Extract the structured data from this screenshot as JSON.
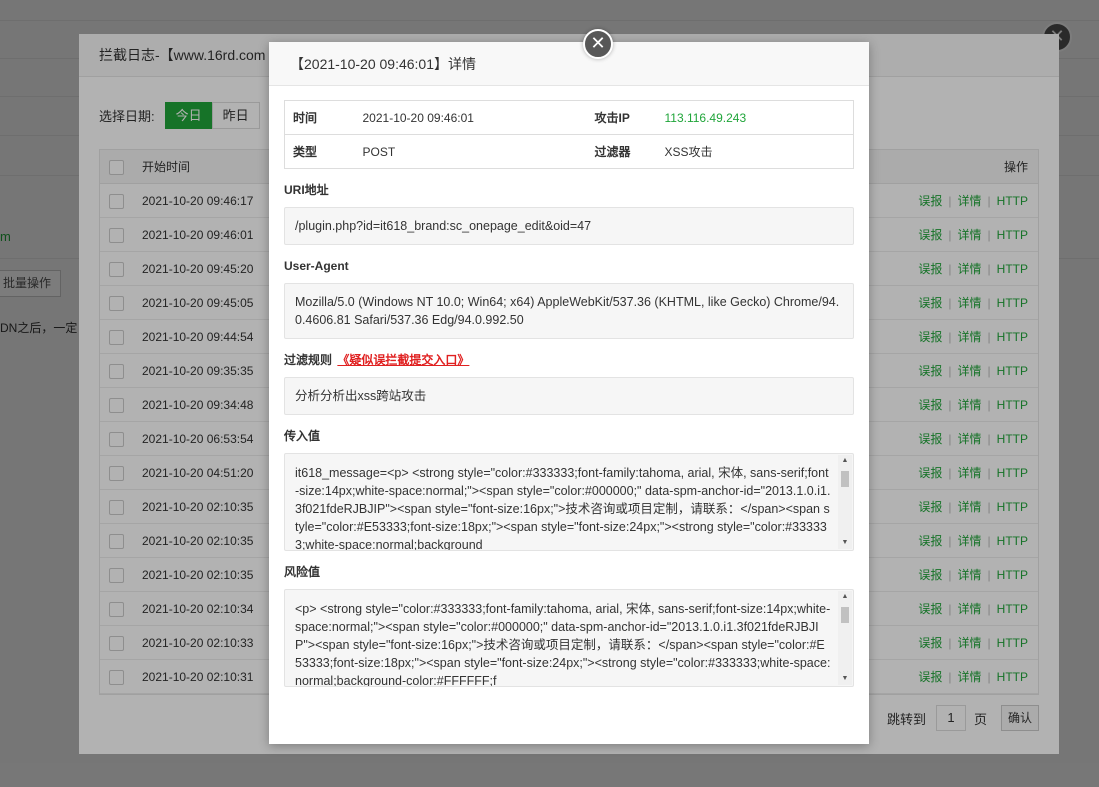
{
  "background": {
    "domain_fragment": "m",
    "batch_button": "批量操作",
    "note_fragment": "DN之后，一定"
  },
  "log_dialog": {
    "title": "拦截日志-【www.16rd.com",
    "date_label": "选择日期:",
    "date_buttons": [
      "今日",
      "昨日"
    ],
    "table_headers": {
      "start_time": "开始时间",
      "operation": "操作"
    },
    "operations": {
      "false_report": "误报",
      "detail": "详情",
      "http": "HTTP",
      "separator": "|"
    },
    "rows": [
      "2021-10-20 09:46:17",
      "2021-10-20 09:46:01",
      "2021-10-20 09:45:20",
      "2021-10-20 09:45:05",
      "2021-10-20 09:44:54",
      "2021-10-20 09:35:35",
      "2021-10-20 09:34:48",
      "2021-10-20 06:53:54",
      "2021-10-20 04:51:20",
      "2021-10-20 02:10:35",
      "2021-10-20 02:10:35",
      "2021-10-20 02:10:35",
      "2021-10-20 02:10:34",
      "2021-10-20 02:10:33",
      "2021-10-20 02:10:31"
    ],
    "pager": {
      "jump_label": "跳转到",
      "page_value": "1",
      "unit": "页",
      "confirm": "确认"
    }
  },
  "detail": {
    "title": "【2021-10-20 09:46:01】详情",
    "close_icon": "close-icon",
    "info": {
      "time_label": "时间",
      "time_value": "2021-10-20 09:46:01",
      "ip_label": "攻击IP",
      "ip_value": "113.116.49.243",
      "type_label": "类型",
      "type_value": "POST",
      "filter_label": "过滤器",
      "filter_value": "XSS攻击"
    },
    "uri_label": "URI地址",
    "uri_value": "/plugin.php?id=it618_brand:sc_onepage_edit&oid=47",
    "ua_label": "User-Agent",
    "ua_value": "Mozilla/5.0 (Windows NT 10.0; Win64; x64) AppleWebKit/537.36 (KHTML, like Gecko) Chrome/94.0.4606.81 Safari/537.36 Edg/94.0.992.50",
    "rule_label": "过滤规则",
    "rule_report_link": "《疑似误拦截提交入口》",
    "rule_value": "分析分析出xss跨站攻击",
    "input_label": "传入值",
    "input_value": "it618_message=<p> <strong style=\"color:#333333;font-family:tahoma, arial, 宋体, sans-serif;font-size:14px;white-space:normal;\"><span style=\"color:#000000;\" data-spm-anchor-id=\"2013.1.0.i1.3f021fdeRJBJIP\"><span style=\"font-size:16px;\">技术咨询或项目定制，请联系：</span><span style=\"color:#E53333;font-size:18px;\"><span style=\"font-size:24px;\"><strong style=\"color:#333333;white-space:normal;background",
    "risk_label": "风险值",
    "risk_value": "<p> <strong style=\"color:#333333;font-family:tahoma, arial, 宋体, sans-serif;font-size:14px;white-space:normal;\"><span style=\"color:#000000;\" data-spm-anchor-id=\"2013.1.0.i1.3f021fdeRJBJIP\"><span style=\"font-size:16px;\">技术咨询或项目定制，请联系：</span><span style=\"color:#E53333;font-size:18px;\"><span style=\"font-size:24px;\"><strong style=\"color:#333333;white-space:normal;background-color:#FFFFFF;f"
  },
  "colors": {
    "accent": "#20a53a",
    "link_red": "#e02020",
    "overlay": "rgba(0,0,0,0.3)"
  }
}
